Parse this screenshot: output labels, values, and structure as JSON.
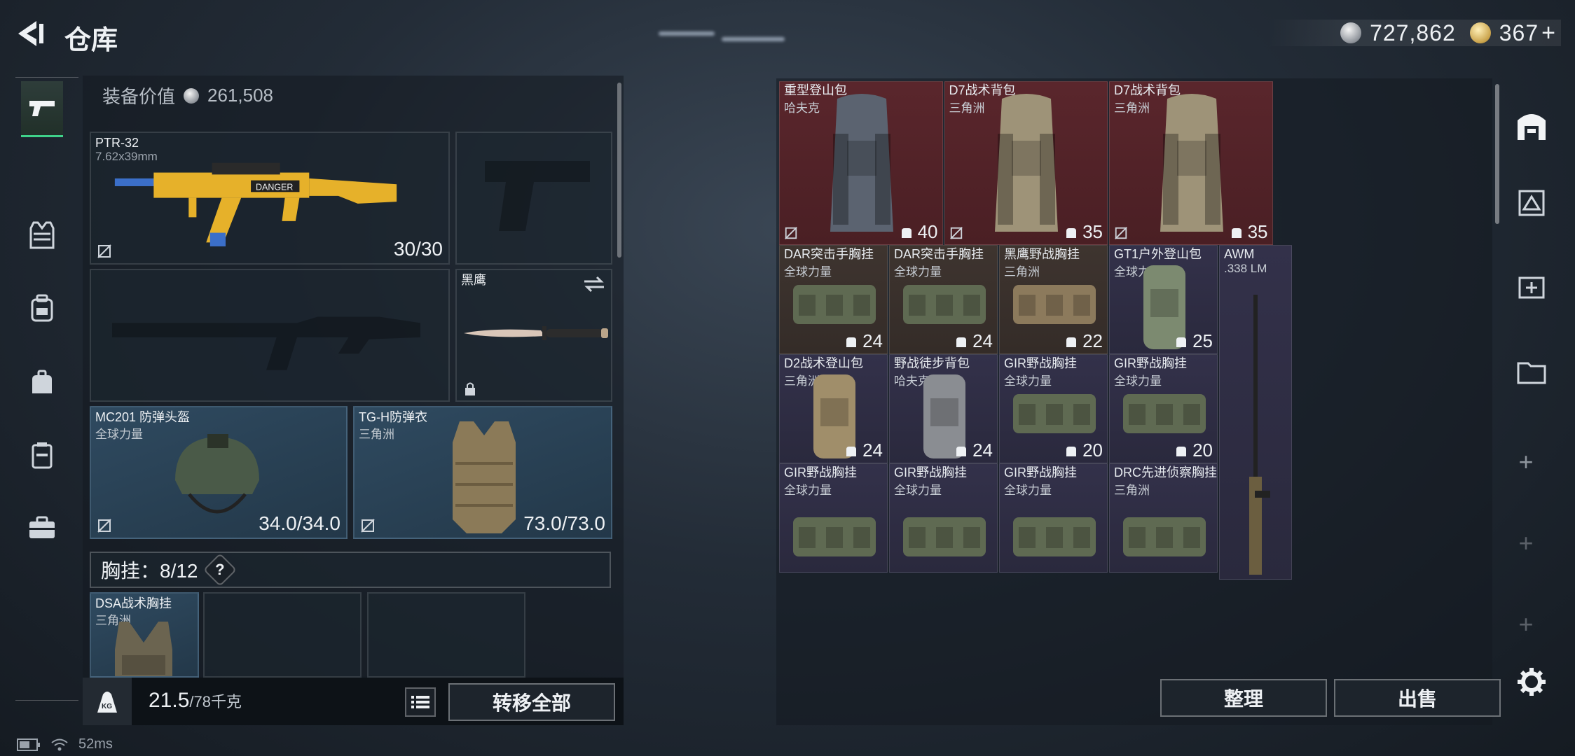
{
  "header": {
    "title": "仓库",
    "currency_silver": "727,862",
    "currency_gold": "367",
    "add_symbol": "+"
  },
  "equipment": {
    "value_label": "装备价值",
    "value": "261,508",
    "primary_weapon": {
      "name": "PTR-32",
      "ammo": "7.62x39mm",
      "count": "30/30"
    },
    "melee": {
      "name": "黑鹰"
    },
    "helmet": {
      "name": "MC201 防弹头盔",
      "maker": "全球力量",
      "durability": "34.0/34.0"
    },
    "armor": {
      "name": "TG-H防弹衣",
      "maker": "三角洲",
      "durability": "73.0/73.0"
    },
    "chest_rig_label": "胸挂：8/12",
    "help_label": "?",
    "chest_item": {
      "name": "DSA战术胸挂",
      "maker": "三角洲"
    }
  },
  "footer": {
    "weight": "21.5",
    "weight_max": "/78千克",
    "weight_icon_label": "KG",
    "transfer_all": "转移全部"
  },
  "warehouse": {
    "items": [
      {
        "name": "重型登山包",
        "maker": "哈夫克",
        "value": "40",
        "color": "red"
      },
      {
        "name": "D7战术背包",
        "maker": "三角洲",
        "value": "35",
        "color": "red"
      },
      {
        "name": "D7战术背包",
        "maker": "三角洲",
        "value": "35",
        "color": "red"
      },
      {
        "name": "DAR突击手胸挂",
        "maker": "全球力量",
        "value": "24",
        "color": "green"
      },
      {
        "name": "DAR突击手胸挂",
        "maker": "全球力量",
        "value": "24",
        "color": "green"
      },
      {
        "name": "黑鹰野战胸挂",
        "maker": "三角洲",
        "value": "22",
        "color": "green"
      },
      {
        "name": "GT1户外登山包",
        "maker": "全球力量",
        "value": "25",
        "color": "purple"
      },
      {
        "name": "AWM",
        "maker": ".338 LM",
        "value": "",
        "color": "purple"
      },
      {
        "name": "D2战术登山包",
        "maker": "三角洲",
        "value": "24",
        "color": "purple"
      },
      {
        "name": "野战徒步背包",
        "maker": "哈夫克",
        "value": "24",
        "color": "purple"
      },
      {
        "name": "GIR野战胸挂",
        "maker": "全球力量",
        "value": "20",
        "color": "purple"
      },
      {
        "name": "GIR野战胸挂",
        "maker": "全球力量",
        "value": "20",
        "color": "purple"
      },
      {
        "name": "GIR野战胸挂",
        "maker": "全球力量",
        "value": "",
        "color": "purple"
      },
      {
        "name": "GIR野战胸挂",
        "maker": "全球力量",
        "value": "",
        "color": "purple"
      },
      {
        "name": "GIR野战胸挂",
        "maker": "全球力量",
        "value": "",
        "color": "purple"
      },
      {
        "name": "DRC先进侦察胸挂",
        "maker": "三角洲",
        "value": "",
        "color": "purple"
      }
    ],
    "sort_label": "整理",
    "sell_label": "出售"
  },
  "status": {
    "ping": "52ms"
  },
  "colors": {
    "accent_green": "#3fd28a",
    "rarity_red": "#5a262c",
    "rarity_purple": "#33314a",
    "rarity_brown": "#3e342f"
  }
}
